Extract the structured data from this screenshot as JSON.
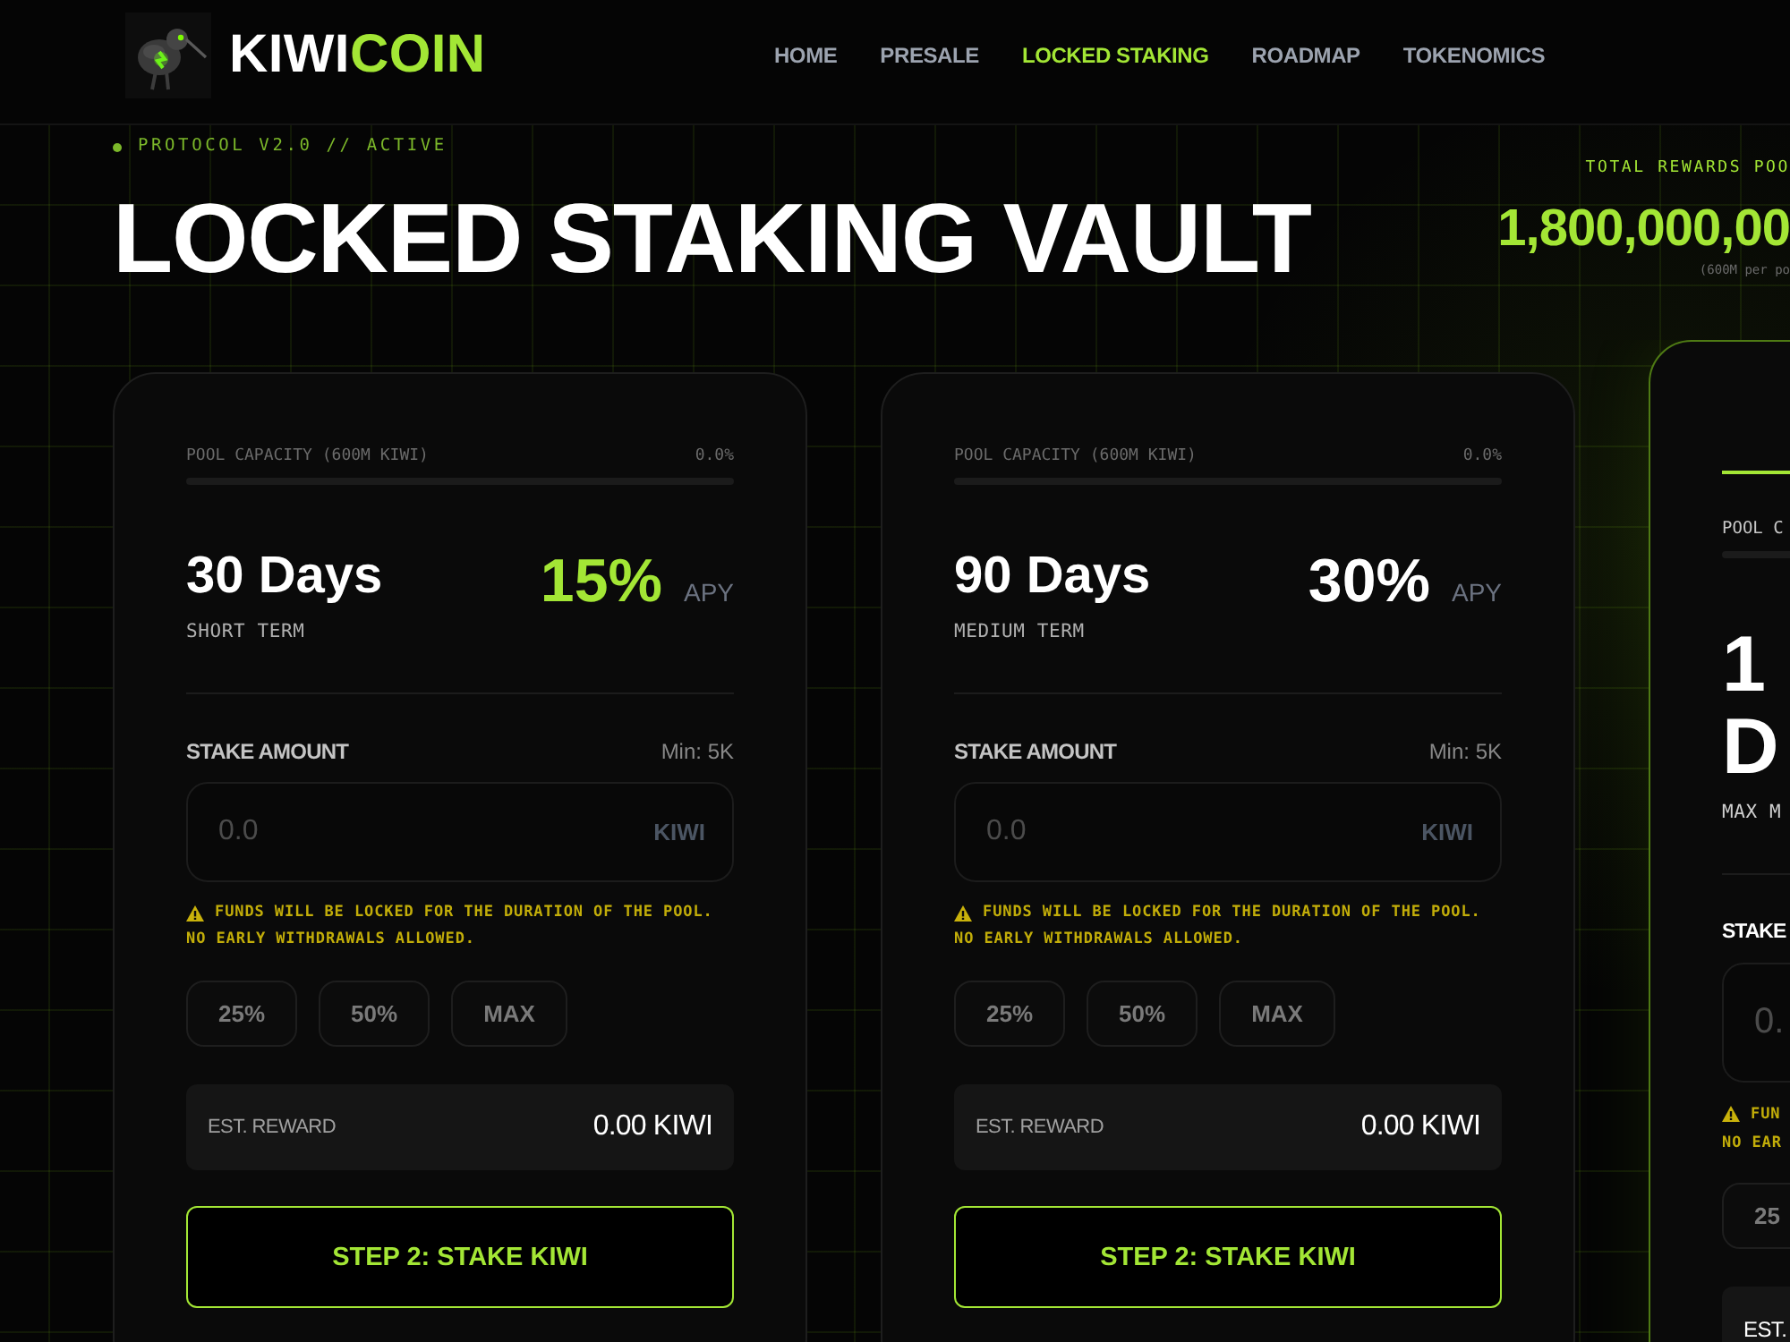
{
  "header": {
    "brand": {
      "name": "KIWI",
      "accent": "COIN"
    },
    "nav": [
      {
        "label": "HOME",
        "selected": false
      },
      {
        "label": "PRESALE",
        "selected": false
      },
      {
        "label": "LOCKED STAKING",
        "selected": true
      },
      {
        "label": "ROADMAP",
        "selected": false
      },
      {
        "label": "TOKENOMICS",
        "selected": false
      }
    ]
  },
  "hero": {
    "status": "PROTOCOL V2.0 // ACTIVE",
    "title": "LOCKED STAKING VAULT",
    "rewards": {
      "label": "TOTAL REWARDS POO",
      "value": "1,800,000,00",
      "note": "(600M per po"
    }
  },
  "pools": [
    {
      "featured": false,
      "capacity_label": "POOL CAPACITY (600M KIWI)",
      "capacity_reading": "0.0%",
      "level": 0,
      "duration": "30 Days",
      "term": "SHORT TERM",
      "apy": "15%",
      "apy_highlighted": true,
      "apy_label": "APY",
      "amount_label": "STAKE AMOUNT",
      "minimum": "Min: 5K",
      "placeholder": "0.0",
      "unit": "KIWI",
      "warning_lines": [
        "FUNDS WILL BE LOCKED FOR THE DURATION OF THE POOL.",
        "NO EARLY WITHDRAWALS ALLOWED."
      ],
      "presets": [
        "25%",
        "50%",
        "MAX"
      ],
      "reward_label": "EST. REWARD",
      "reward": "0.00 KIWI",
      "action": "STEP 2: STAKE KIWI"
    },
    {
      "featured": false,
      "capacity_label": "POOL CAPACITY (600M KIWI)",
      "capacity_reading": "0.0%",
      "level": 0,
      "duration": "90 Days",
      "term": "MEDIUM TERM",
      "apy": "30%",
      "apy_highlighted": false,
      "apy_label": "APY",
      "amount_label": "STAKE AMOUNT",
      "minimum": "Min: 5K",
      "placeholder": "0.0",
      "unit": "KIWI",
      "warning_lines": [
        "FUNDS WILL BE LOCKED FOR THE DURATION OF THE POOL.",
        "NO EARLY WITHDRAWALS ALLOWED."
      ],
      "presets": [
        "25%",
        "50%",
        "MAX"
      ],
      "reward_label": "EST. REWARD",
      "reward": "0.00 KIWI",
      "action": "STEP 2: STAKE KIWI"
    },
    {
      "featured": true,
      "capacity_label": "POOL C",
      "level": 0,
      "duration": "1 D",
      "term": "MAX M",
      "amount_label": "STAKE",
      "placeholder": "0.",
      "warning_lines": [
        "FUN",
        "NO EAR"
      ],
      "presets": [
        "25"
      ],
      "reward_label": "EST."
    }
  ]
}
